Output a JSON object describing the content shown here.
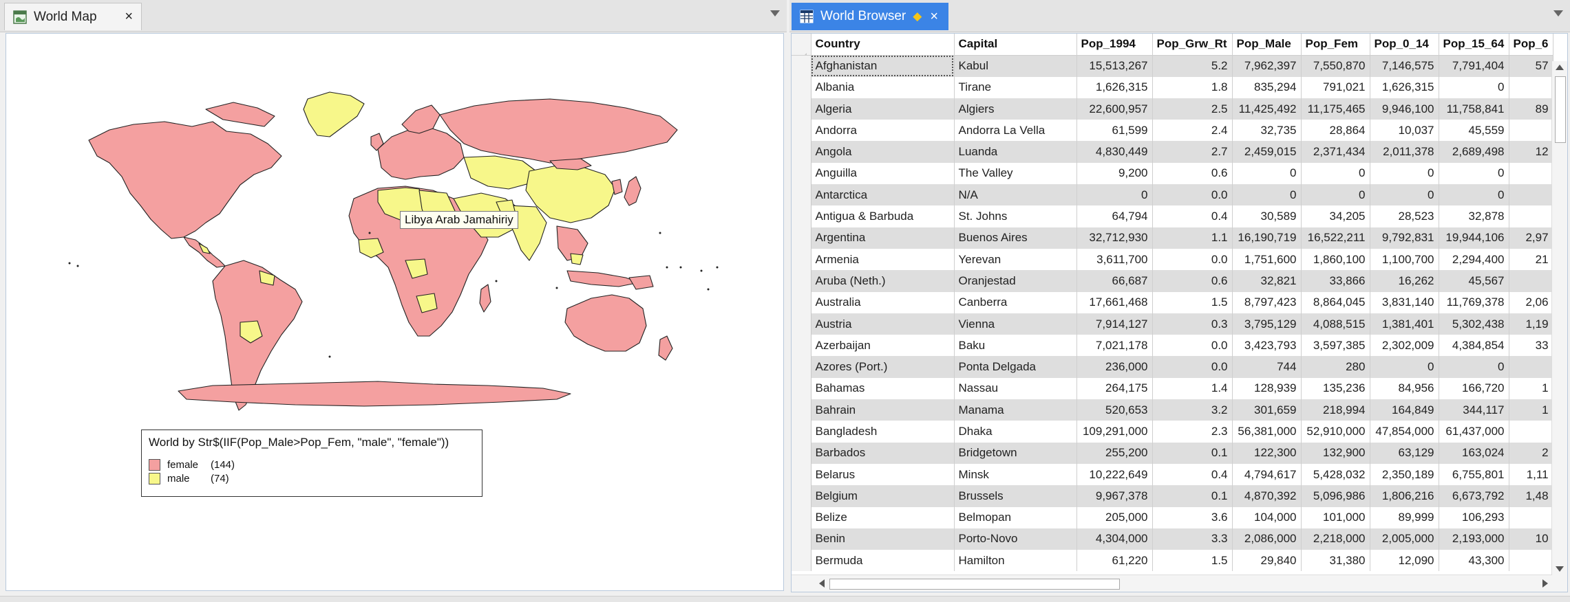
{
  "map_window": {
    "tab_title": "World Map",
    "close_glyph": "×",
    "tooltip": "Libya Arab Jamahiriy",
    "legend": {
      "title": "World by Str$(IIF(Pop_Male>Pop_Fem, \"male\", \"female\"))",
      "items": [
        {
          "label": "female",
          "count": "(144)",
          "color": "#f4a0a0"
        },
        {
          "label": "male",
          "count": "(74)",
          "color": "#f7f78a"
        }
      ]
    },
    "colors": {
      "female": "#f4a0a0",
      "male": "#f7f78a"
    }
  },
  "browser_window": {
    "tab_title": "World Browser",
    "close_glyph": "×",
    "dirty_glyph": "◆",
    "active_color": "#3b84e6",
    "columns": [
      "Country",
      "Capital",
      "Pop_1994",
      "Pop_Grw_Rt",
      "Pop_Male",
      "Pop_Fem",
      "Pop_0_14",
      "Pop_15_64",
      "Pop_6"
    ],
    "rows": [
      [
        "Afghanistan",
        "Kabul",
        "15,513,267",
        "5.2",
        "7,962,397",
        "7,550,870",
        "7,146,575",
        "7,791,404",
        "57"
      ],
      [
        "Albania",
        "Tirane",
        "1,626,315",
        "1.8",
        "835,294",
        "791,021",
        "1,626,315",
        "0",
        ""
      ],
      [
        "Algeria",
        "Algiers",
        "22,600,957",
        "2.5",
        "11,425,492",
        "11,175,465",
        "9,946,100",
        "11,758,841",
        "89"
      ],
      [
        "Andorra",
        "Andorra La Vella",
        "61,599",
        "2.4",
        "32,735",
        "28,864",
        "10,037",
        "45,559",
        ""
      ],
      [
        "Angola",
        "Luanda",
        "4,830,449",
        "2.7",
        "2,459,015",
        "2,371,434",
        "2,011,378",
        "2,689,498",
        "12"
      ],
      [
        "Anguilla",
        "The Valley",
        "9,200",
        "0.6",
        "0",
        "0",
        "0",
        "0",
        ""
      ],
      [
        "Antarctica",
        "N/A",
        "0",
        "0.0",
        "0",
        "0",
        "0",
        "0",
        ""
      ],
      [
        "Antigua & Barbuda",
        "St. Johns",
        "64,794",
        "0.4",
        "30,589",
        "34,205",
        "28,523",
        "32,878",
        ""
      ],
      [
        "Argentina",
        "Buenos Aires",
        "32,712,930",
        "1.1",
        "16,190,719",
        "16,522,211",
        "9,792,831",
        "19,944,106",
        "2,97"
      ],
      [
        "Armenia",
        "Yerevan",
        "3,611,700",
        "0.0",
        "1,751,600",
        "1,860,100",
        "1,100,700",
        "2,294,400",
        "21"
      ],
      [
        "Aruba (Neth.)",
        "Oranjestad",
        "66,687",
        "0.6",
        "32,821",
        "33,866",
        "16,262",
        "45,567",
        ""
      ],
      [
        "Australia",
        "Canberra",
        "17,661,468",
        "1.5",
        "8,797,423",
        "8,864,045",
        "3,831,140",
        "11,769,378",
        "2,06"
      ],
      [
        "Austria",
        "Vienna",
        "7,914,127",
        "0.3",
        "3,795,129",
        "4,088,515",
        "1,381,401",
        "5,302,438",
        "1,19"
      ],
      [
        "Azerbaijan",
        "Baku",
        "7,021,178",
        "0.0",
        "3,423,793",
        "3,597,385",
        "2,302,009",
        "4,384,854",
        "33"
      ],
      [
        "Azores (Port.)",
        "Ponta Delgada",
        "236,000",
        "0.0",
        "744",
        "280",
        "0",
        "0",
        ""
      ],
      [
        "Bahamas",
        "Nassau",
        "264,175",
        "1.4",
        "128,939",
        "135,236",
        "84,956",
        "166,720",
        "1"
      ],
      [
        "Bahrain",
        "Manama",
        "520,653",
        "3.2",
        "301,659",
        "218,994",
        "164,849",
        "344,117",
        "1"
      ],
      [
        "Bangladesh",
        "Dhaka",
        "109,291,000",
        "2.3",
        "56,381,000",
        "52,910,000",
        "47,854,000",
        "61,437,000",
        ""
      ],
      [
        "Barbados",
        "Bridgetown",
        "255,200",
        "0.1",
        "122,300",
        "132,900",
        "63,129",
        "163,024",
        "2"
      ],
      [
        "Belarus",
        "Minsk",
        "10,222,649",
        "0.4",
        "4,794,617",
        "5,428,032",
        "2,350,189",
        "6,755,801",
        "1,11"
      ],
      [
        "Belgium",
        "Brussels",
        "9,967,378",
        "0.1",
        "4,870,392",
        "5,096,986",
        "1,806,216",
        "6,673,792",
        "1,48"
      ],
      [
        "Belize",
        "Belmopan",
        "205,000",
        "3.6",
        "104,000",
        "101,000",
        "89,999",
        "106,293",
        ""
      ],
      [
        "Benin",
        "Porto-Novo",
        "4,304,000",
        "3.3",
        "2,086,000",
        "2,218,000",
        "2,005,000",
        "2,193,000",
        "10"
      ],
      [
        "Bermuda",
        "Hamilton",
        "61,220",
        "1.5",
        "29,840",
        "31,380",
        "12,090",
        "43,300",
        ""
      ]
    ]
  }
}
